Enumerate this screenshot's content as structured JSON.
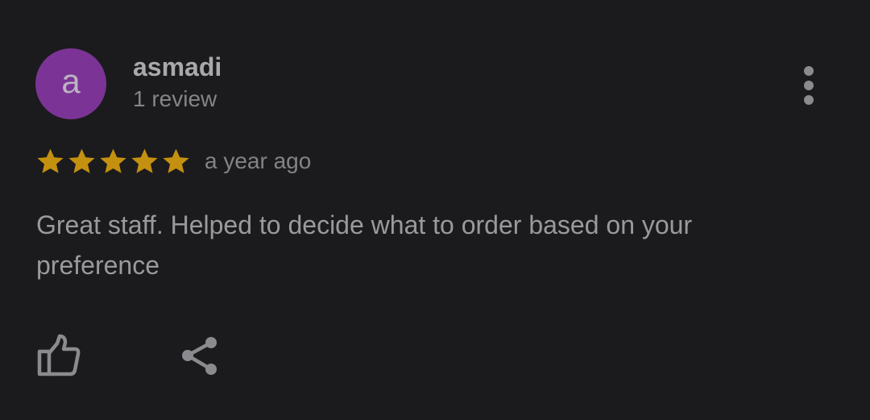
{
  "review": {
    "avatar_letter": "a",
    "avatar_color": "#7b3496",
    "reviewer_name": "asmadi",
    "review_count": "1 review",
    "rating": 5,
    "rating_max": 5,
    "time_ago": "a year ago",
    "text": "Great staff. Helped to decide what to order based on your preference"
  },
  "colors": {
    "background": "#1b1b1d",
    "star": "#c4900f",
    "icon": "#8b8b8f"
  },
  "icons": {
    "more": "more-vert-icon",
    "star": "star-icon",
    "like": "thumb-up-icon",
    "share": "share-icon"
  }
}
